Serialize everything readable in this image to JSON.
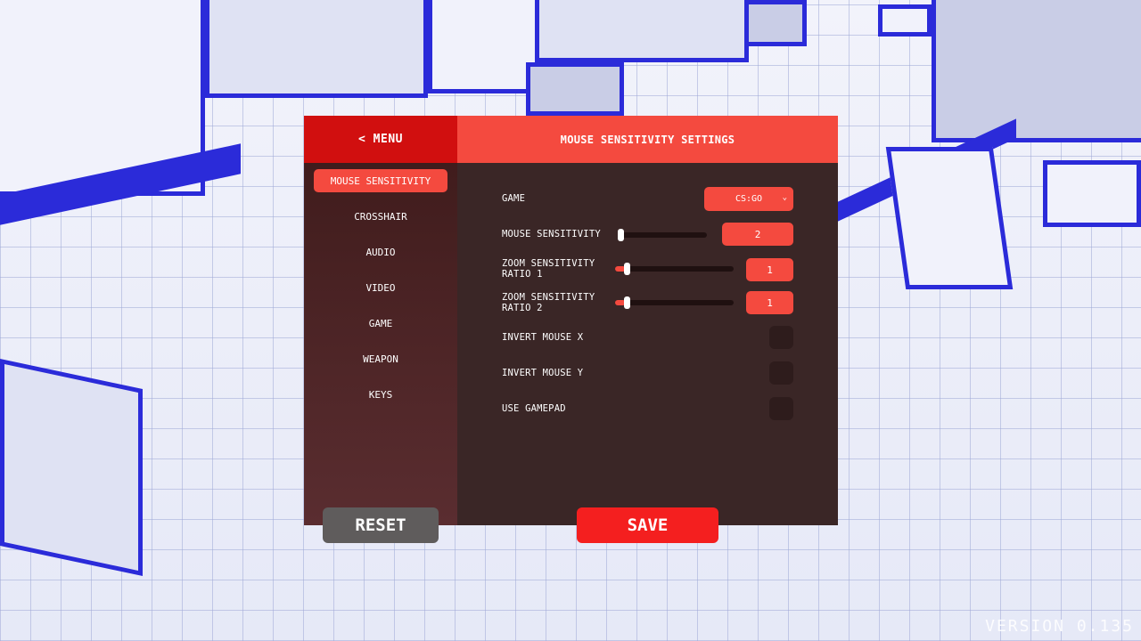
{
  "menu": {
    "back_label": "< MENU"
  },
  "header": {
    "title": "MOUSE SENSITIVITY SETTINGS"
  },
  "nav": {
    "items": [
      {
        "label": "MOUSE SENSITIVITY",
        "active": true
      },
      {
        "label": "CROSSHAIR"
      },
      {
        "label": "AUDIO"
      },
      {
        "label": "VIDEO"
      },
      {
        "label": "GAME"
      },
      {
        "label": "WEAPON"
      },
      {
        "label": "KEYS"
      }
    ]
  },
  "settings": {
    "game": {
      "label": "GAME",
      "selected": "CS:GO"
    },
    "mouse_sensitivity": {
      "label": "MOUSE SENSITIVITY",
      "value": "2"
    },
    "zoom_ratio_1": {
      "label_line1": "ZOOM SENSITIVITY",
      "label_line2": "RATIO 1",
      "value": "1"
    },
    "zoom_ratio_2": {
      "label_line1": "ZOOM SENSITIVITY",
      "label_line2": "RATIO 2",
      "value": "1"
    },
    "invert_x": {
      "label": "INVERT MOUSE X",
      "checked": false
    },
    "invert_y": {
      "label": "INVERT MOUSE Y",
      "checked": false
    },
    "use_gamepad": {
      "label": "USE GAMEPAD",
      "checked": false
    }
  },
  "buttons": {
    "reset": "RESET",
    "save": "SAVE"
  },
  "version": {
    "label": "VERSION",
    "number": "0.135"
  },
  "colors": {
    "accent": "#f44a3f",
    "menu_red": "#d10f0f",
    "panel": "#3a2626",
    "reset_gray": "#5f5c5c",
    "scene_blue": "#2b2bd9"
  }
}
